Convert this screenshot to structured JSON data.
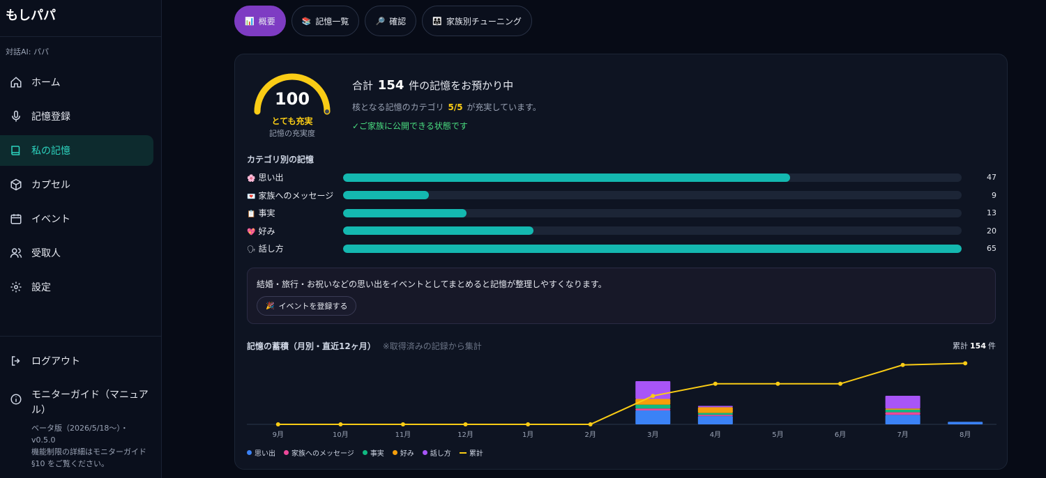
{
  "app": {
    "title": "もしパパ",
    "subtitle": "対話AI: パパ"
  },
  "sidebar": {
    "items": [
      {
        "label": "ホーム",
        "icon": "home-icon"
      },
      {
        "label": "記憶登録",
        "icon": "microphone-icon"
      },
      {
        "label": "私の記憶",
        "icon": "book-icon",
        "active": true
      },
      {
        "label": "カプセル",
        "icon": "box-icon"
      },
      {
        "label": "イベント",
        "icon": "calendar-icon"
      },
      {
        "label": "受取人",
        "icon": "users-icon"
      },
      {
        "label": "設定",
        "icon": "gear-icon"
      }
    ],
    "logout": "ログアウト",
    "guide": {
      "title": "モニターガイド（マニュアル）",
      "version": "ベータ版（2026/5/18〜）・v0.5.0",
      "note": "機能制限の詳細はモニターガイド §10 をご覧ください。"
    }
  },
  "tabs": [
    {
      "emoji": "📊",
      "label": "概要",
      "active": true
    },
    {
      "emoji": "📚",
      "label": "記憶一覧"
    },
    {
      "emoji": "🔎",
      "label": "確認"
    },
    {
      "emoji": "👨‍👩‍👧",
      "label": "家族別チューニング"
    }
  ],
  "gauge": {
    "value": "100",
    "level": "とても充実",
    "caption": "記憶の充実度",
    "fraction": 1.0,
    "color": "#facc15"
  },
  "summary": {
    "prefix": "合計",
    "count": "154",
    "suffix": "件の記憶をお預かり中",
    "sub_prefix": "核となる記憶のカテゴリ",
    "sub_value": "5/5",
    "sub_suffix": "が充実しています。",
    "ok": "✓ご家族に公開できる状態です"
  },
  "categories": {
    "title": "カテゴリ別の記憶",
    "max": 65,
    "rows": [
      {
        "emoji": "🌸",
        "label": "思い出",
        "count": 47
      },
      {
        "emoji": "💌",
        "label": "家族へのメッセージ",
        "count": 9
      },
      {
        "emoji": "📋",
        "label": "事実",
        "count": 13
      },
      {
        "emoji": "💖",
        "label": "好み",
        "count": 20
      },
      {
        "emoji": "🗣",
        "label": "話し方",
        "count": 65
      }
    ]
  },
  "tip": {
    "text": "結婚・旅行・お祝いなどの思い出をイベントとしてまとめると記憶が整理しやすくなります。",
    "button_emoji": "🎉",
    "button": "イベントを登録する"
  },
  "chart_title": {
    "title": "記憶の蓄積（月別・直近12ヶ月）",
    "note": "※取得済みの記録から集計",
    "total_prefix": "累計",
    "total_value": "154",
    "total_suffix": "件"
  },
  "chart_data": {
    "type": "bar",
    "stacked": true,
    "categories": [
      "9月",
      "10月",
      "11月",
      "12月",
      "1月",
      "2月",
      "3月",
      "4月",
      "5月",
      "6月",
      "7月",
      "8月"
    ],
    "series": [
      {
        "name": "思い出",
        "color": "#3b82f6",
        "values": [
          0,
          0,
          0,
          0,
          0,
          0,
          22,
          13,
          0,
          0,
          15,
          4
        ]
      },
      {
        "name": "家族へのメッセージ",
        "color": "#ec4899",
        "values": [
          0,
          0,
          0,
          0,
          0,
          0,
          3,
          2,
          0,
          0,
          4,
          0
        ]
      },
      {
        "name": "事実",
        "color": "#10b981",
        "values": [
          0,
          0,
          0,
          0,
          0,
          0,
          6,
          3,
          0,
          0,
          4,
          0
        ]
      },
      {
        "name": "好み",
        "color": "#f59e0b",
        "values": [
          0,
          0,
          0,
          0,
          0,
          0,
          9,
          9,
          0,
          0,
          2,
          0
        ]
      },
      {
        "name": "話し方",
        "color": "#a855f7",
        "values": [
          0,
          0,
          0,
          0,
          0,
          0,
          28,
          2,
          0,
          0,
          20,
          0
        ]
      }
    ],
    "line": {
      "name": "累計",
      "color": "#facc15",
      "values": [
        0,
        0,
        0,
        0,
        0,
        0,
        68,
        97,
        97,
        97,
        142,
        146
      ]
    },
    "ylim": [
      0,
      150
    ],
    "legend": "bottom-left"
  }
}
